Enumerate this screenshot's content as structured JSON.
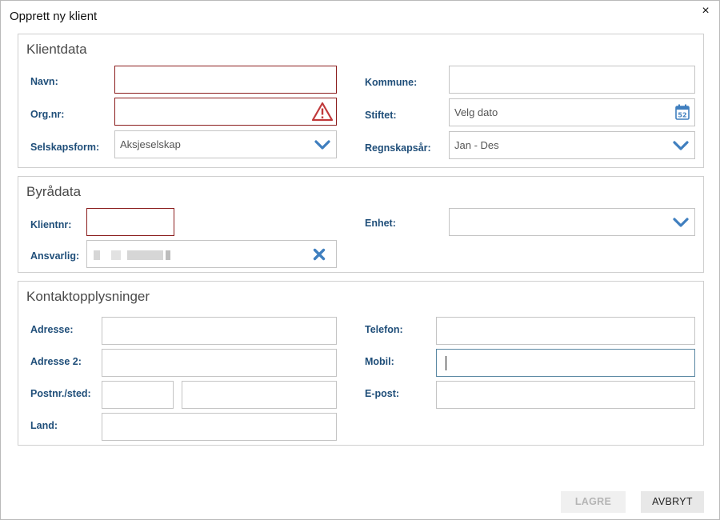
{
  "dialog": {
    "title": "Opprett ny klient",
    "close_glyph": "×"
  },
  "klientdata": {
    "title": "Klientdata",
    "navn_label": "Navn:",
    "orgnr_label": "Org.nr:",
    "selskapsform_label": "Selskapsform:",
    "selskapsform_value": "Aksjeselskap",
    "kommune_label": "Kommune:",
    "stiftet_label": "Stiftet:",
    "stiftet_placeholder": "Velg dato",
    "calendar_day": "52",
    "regnskapsar_label": "Regnskapsår:",
    "regnskapsar_value": "Jan - Des"
  },
  "byradata": {
    "title": "Byrådata",
    "klientnr_label": "Klientnr:",
    "ansvarlig_label": "Ansvarlig:",
    "enhet_label": "Enhet:"
  },
  "kontakt": {
    "title": "Kontaktopplysninger",
    "adresse_label": "Adresse:",
    "adresse2_label": "Adresse 2:",
    "postnr_label": "Postnr./sted:",
    "land_label": "Land:",
    "telefon_label": "Telefon:",
    "mobil_label": "Mobil:",
    "epost_label": "E-post:"
  },
  "buttons": {
    "save": "LAGRE",
    "cancel": "AVBRYT"
  },
  "colors": {
    "label": "#1f4e79",
    "error_border": "#8b1d1d",
    "icon_blue": "#3f7fbf",
    "warning_red": "#c0393b"
  }
}
